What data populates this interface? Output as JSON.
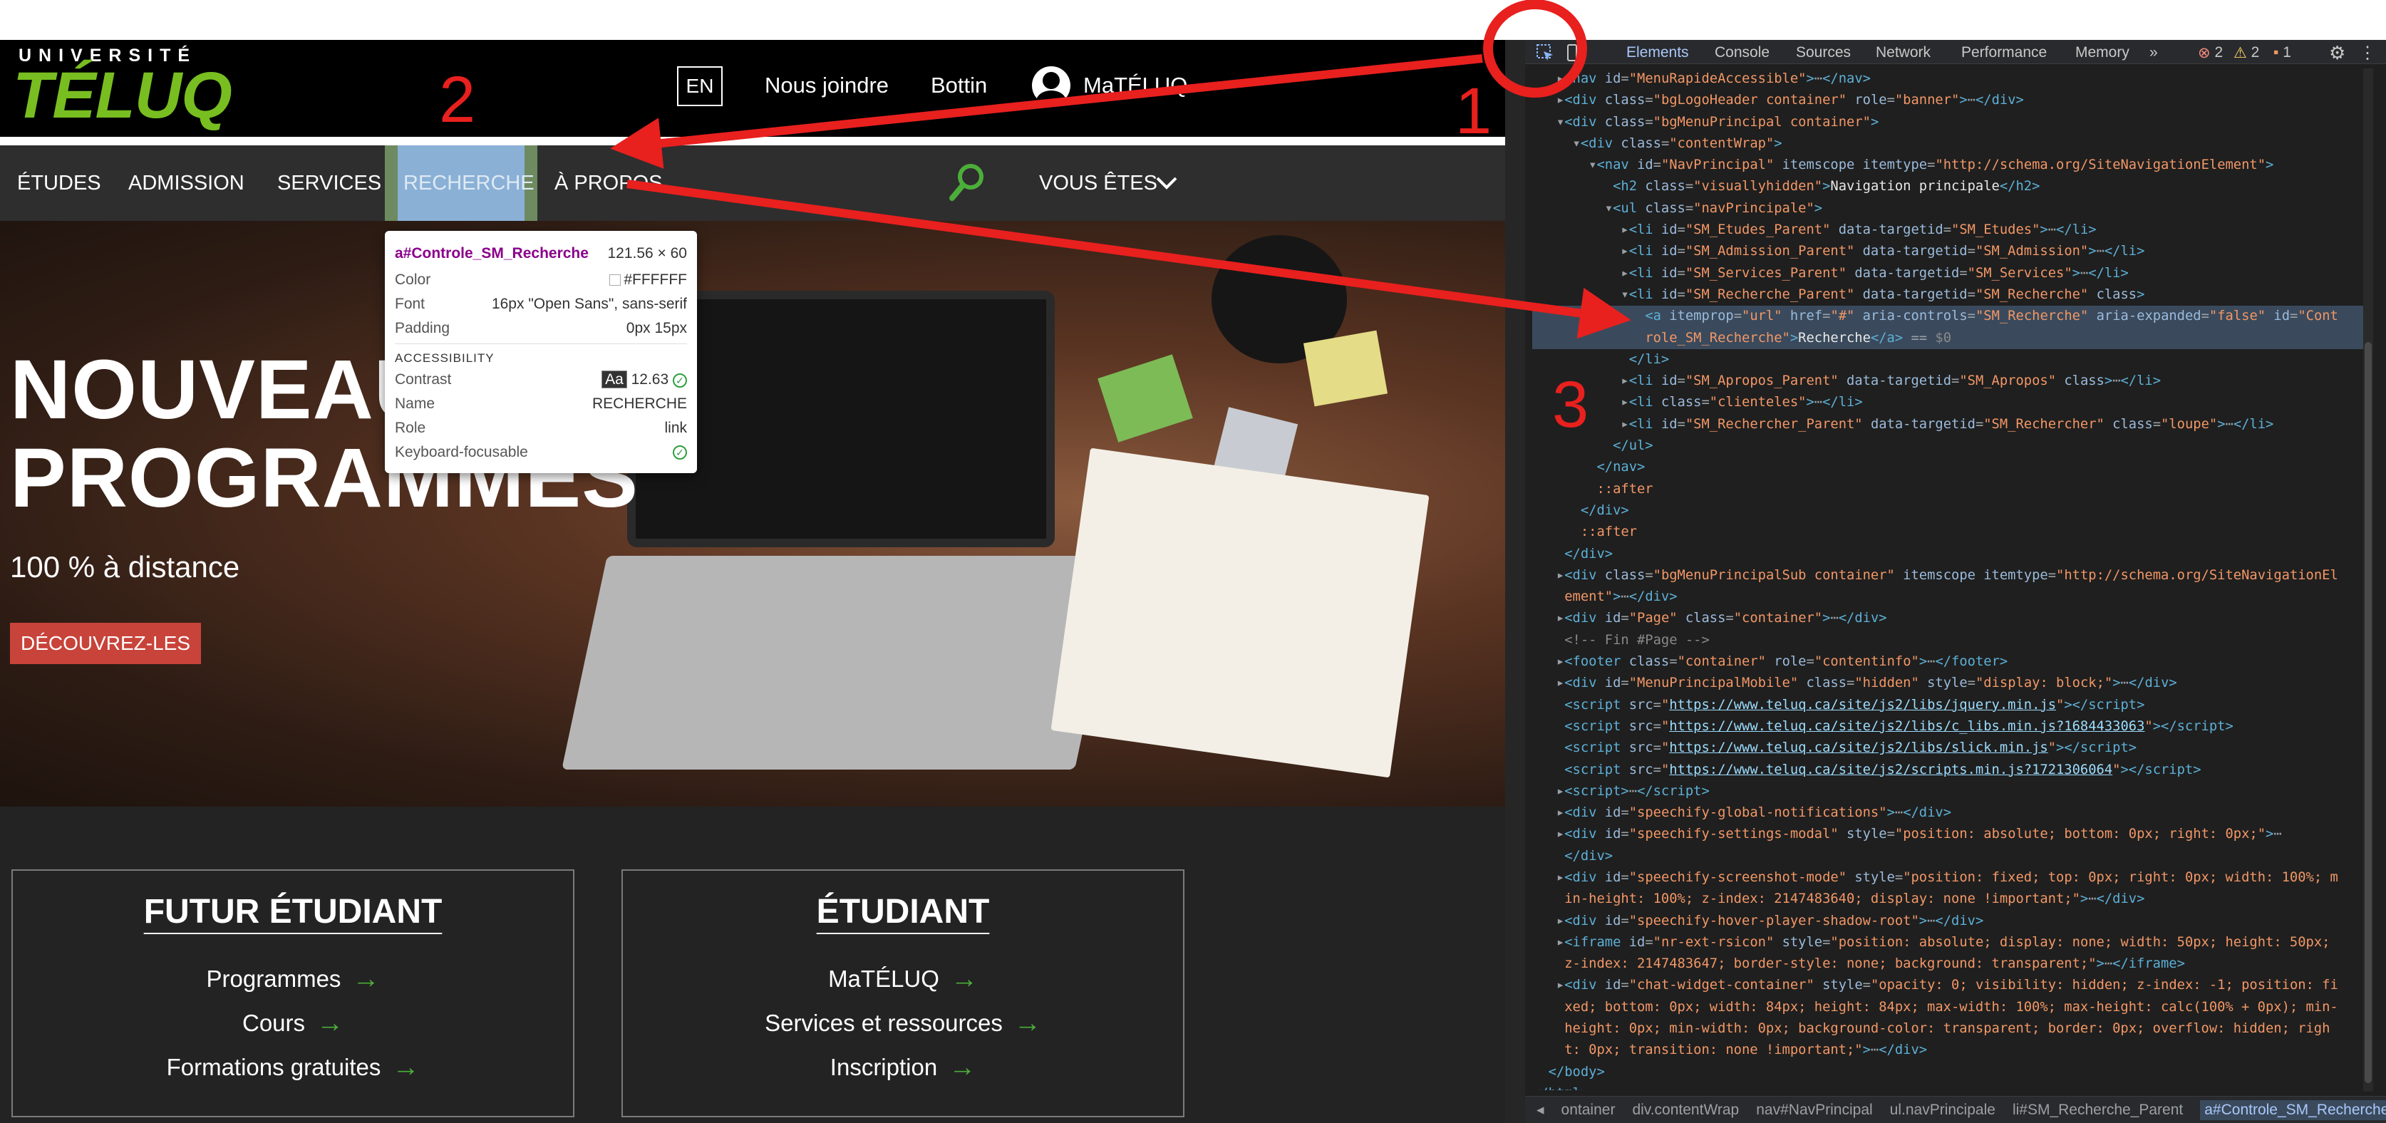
{
  "site": {
    "logo_small": "UNIVERSITÉ",
    "logo_big": "TÉLUQ",
    "header_links": [
      "EN",
      "Nous joindre",
      "Bottin",
      "MaTÉLUQ"
    ],
    "nav": [
      "ÉTUDES",
      "ADMISSION",
      "SERVICES",
      "RECHERCHE",
      "À PROPOS"
    ],
    "nav_extra": "VOUS ÊTES",
    "hero_title_1": "NOUVEAUX",
    "hero_title_2": "PROGRAMMES",
    "hero_sub": "100 % à distance",
    "hero_button": "DÉCOUVREZ-LES",
    "cards": [
      {
        "title": "FUTUR ÉTUDIANT",
        "links": [
          "Programmes",
          "Cours",
          "Formations gratuites"
        ]
      },
      {
        "title": "ÉTUDIANT",
        "links": [
          "MaTÉLUQ",
          "Services et ressources",
          "Inscription"
        ]
      }
    ],
    "tooltip": {
      "selector": "a#Controle_SM_Recherche",
      "size": "121.56 × 60",
      "rows": [
        {
          "label": "Color",
          "value": "#FFFFFF"
        },
        {
          "label": "Font",
          "value": "16px \"Open Sans\", sans-serif"
        },
        {
          "label": "Padding",
          "value": "0px 15px"
        }
      ],
      "section": "ACCESSIBILITY",
      "contrast_label": "Contrast",
      "contrast_badge": "Aa",
      "contrast_value": "12.63",
      "a11y_rows": [
        {
          "label": "Name",
          "value": "RECHERCHE"
        },
        {
          "label": "Role",
          "value": "link"
        },
        {
          "label": "Keyboard-focusable",
          "value": ""
        }
      ]
    }
  },
  "devtools": {
    "tabs": [
      "Elements",
      "Console",
      "Sources",
      "Network",
      "Performance",
      "Memory",
      "»"
    ],
    "errors": "2",
    "warnings": "2",
    "issues": "1",
    "breadcrumb": [
      "◂",
      "ontainer",
      "div.contentWrap",
      "nav#NavPrincipal",
      "ul.navPrincipale",
      "li#SM_Recherche_Parent",
      "a#Controle_SM_Recherche",
      "▸"
    ]
  },
  "annotations": [
    "1",
    "2",
    "3"
  ],
  "colors": {
    "brand_green": "#78be20",
    "annotation_red": "#e8201e",
    "nav_bg": "#2e2e2e",
    "devtools_bg": "#1f1f1f"
  }
}
